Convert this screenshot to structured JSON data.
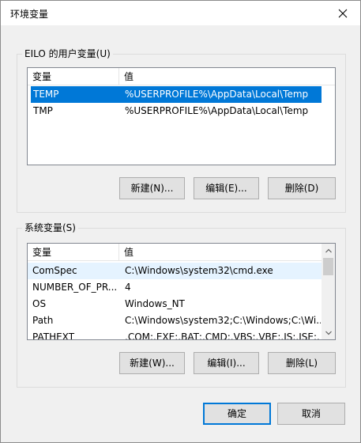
{
  "window": {
    "title": "环境变量",
    "close_icon": "close-icon"
  },
  "user_vars": {
    "group_label": "EILO 的用户变量(U)",
    "headers": [
      "变量",
      "值"
    ],
    "rows": [
      {
        "name": "TEMP",
        "value": "%USERPROFILE%\\AppData\\Local\\Temp",
        "selected": true
      },
      {
        "name": "TMP",
        "value": "%USERPROFILE%\\AppData\\Local\\Temp",
        "selected": false
      }
    ],
    "new_button": "新建(N)...",
    "edit_button": "编辑(E)...",
    "delete_button": "删除(D)"
  },
  "system_vars": {
    "group_label": "系统变量(S)",
    "headers": [
      "变量",
      "值"
    ],
    "rows": [
      {
        "name": "ComSpec",
        "value": "C:\\Windows\\system32\\cmd.exe"
      },
      {
        "name": "NUMBER_OF_PR...",
        "value": "4"
      },
      {
        "name": "OS",
        "value": "Windows_NT"
      },
      {
        "name": "Path",
        "value": "C:\\Windows\\system32;C:\\Windows;C:\\Wi..."
      },
      {
        "name": "PATHEXT",
        "value": ".COM;.EXE;.BAT;.CMD;.VBS;.VBE;.JS;.JSE;..."
      }
    ],
    "new_button": "新建(W)...",
    "edit_button": "编辑(I)...",
    "delete_button": "删除(L)"
  },
  "footer": {
    "ok_button": "确定",
    "cancel_button": "取消"
  },
  "colors": {
    "selection": "#0078d7",
    "hover": "#e5f3ff",
    "default_button_border": "#0078d7"
  }
}
